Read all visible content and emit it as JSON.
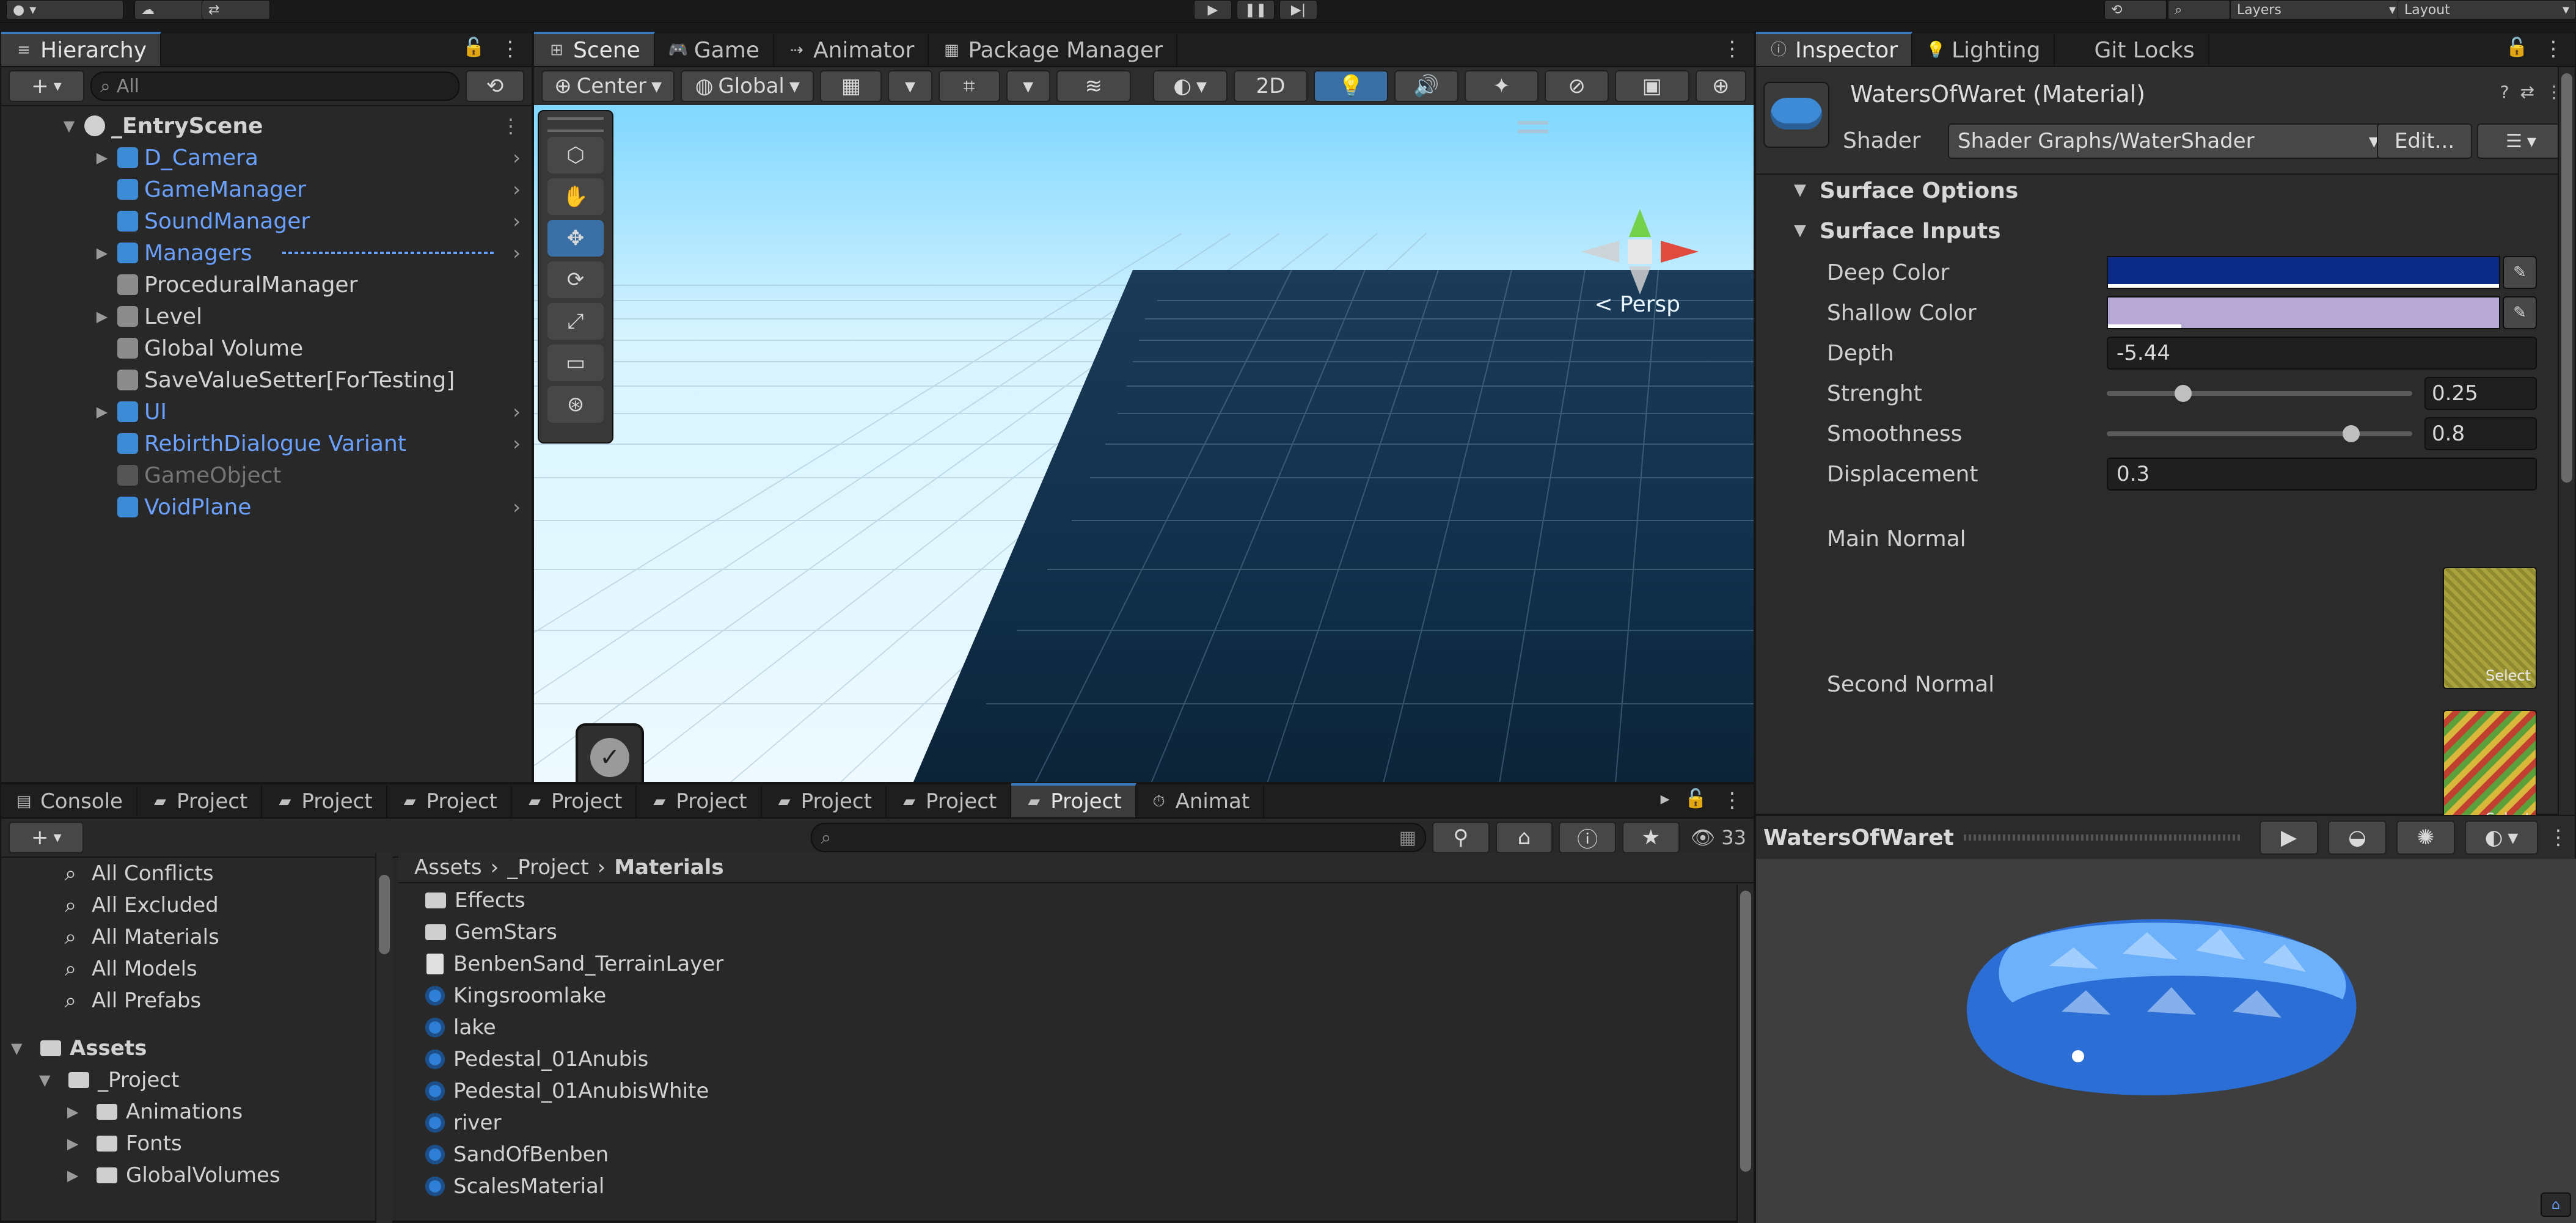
{
  "topbar": {
    "layers_label": "Layers",
    "layout_label": "Layout",
    "play_icon": "play-icon",
    "pause_icon": "pause-icon",
    "step_icon": "step-icon"
  },
  "hierarchy": {
    "tab_label": "Hierarchy",
    "search_placeholder": "All",
    "scene_name": "_EntryScene",
    "items": [
      {
        "label": "D_Camera",
        "blue": true,
        "has_arrow": true,
        "has_right_chevron": true
      },
      {
        "label": "GameManager",
        "blue": true,
        "has_arrow": false,
        "has_right_chevron": true
      },
      {
        "label": "SoundManager",
        "blue": true,
        "has_arrow": false,
        "has_right_chevron": true
      },
      {
        "label": "Managers",
        "blue": true,
        "has_arrow": true,
        "has_right_chevron": true
      },
      {
        "label": "ProceduralManager",
        "blue": false,
        "has_arrow": false,
        "has_right_chevron": false
      },
      {
        "label": "Level",
        "blue": false,
        "has_arrow": true,
        "has_right_chevron": false
      },
      {
        "label": "Global Volume",
        "blue": false,
        "has_arrow": false,
        "has_right_chevron": false
      },
      {
        "label": "SaveValueSetter[ForTesting]",
        "blue": false,
        "has_arrow": false,
        "has_right_chevron": false
      },
      {
        "label": "UI",
        "blue": true,
        "has_arrow": true,
        "has_right_chevron": true
      },
      {
        "label": "RebirthDialogue Variant",
        "blue": true,
        "has_arrow": false,
        "has_right_chevron": true
      },
      {
        "label": "GameObject",
        "blue": false,
        "has_arrow": false,
        "has_right_chevron": false,
        "dim": true
      },
      {
        "label": "VoidPlane",
        "blue": true,
        "has_arrow": false,
        "has_right_chevron": true
      }
    ]
  },
  "scene_tabs": [
    {
      "label": "Scene",
      "active": true,
      "icon": "scene-icon"
    },
    {
      "label": "Game",
      "active": false,
      "icon": "game-icon"
    },
    {
      "label": "Animator",
      "active": false,
      "icon": "animator-icon"
    },
    {
      "label": "Package Manager",
      "active": false,
      "icon": "package-manager-icon"
    }
  ],
  "scene_toolbar": {
    "pivot_label": "Center",
    "space_label": "Global",
    "mode_2d_label": "2D",
    "persp_label": "< Persp"
  },
  "inspector": {
    "tabs": [
      {
        "label": "Inspector",
        "active": true
      },
      {
        "label": "Lighting",
        "active": false
      },
      {
        "label": "Git Locks",
        "active": false
      }
    ],
    "material_title": "WatersOfWaret (Material)",
    "shader_label": "Shader",
    "shader_value": "Shader Graphs/WaterShader",
    "edit_button_label": "Edit...",
    "menu_button_glyph": "☰",
    "sections": [
      {
        "label": "Surface Options"
      },
      {
        "label": "Surface Inputs"
      }
    ],
    "props": {
      "deep_color_label": "Deep Color",
      "shallow_color_label": "Shallow Color",
      "depth_label": "Depth",
      "depth_value": "-5.44",
      "strength_label": "Strenght",
      "strength_value": "0.25",
      "smoothness_label": "Smoothness",
      "smoothness_value": "0.8",
      "displacement_label": "Displacement",
      "displacement_value": "0.3",
      "main_normal_label": "Main Normal",
      "second_normal_label": "Second Normal",
      "select_label": "Select"
    },
    "colors": {
      "deep_color": "#0b2a86",
      "shallow_color": "#b7a9d6"
    },
    "sliders": {
      "strength_fraction": 0.25,
      "smoothness_fraction": 0.8
    }
  },
  "bottom_tabs": [
    {
      "label": "Console",
      "active": false,
      "icon": "console-icon"
    },
    {
      "label": "Project",
      "active": false,
      "icon": "folder-icon"
    },
    {
      "label": "Project",
      "active": false,
      "icon": "folder-icon"
    },
    {
      "label": "Project",
      "active": false,
      "icon": "folder-icon"
    },
    {
      "label": "Project",
      "active": false,
      "icon": "folder-icon"
    },
    {
      "label": "Project",
      "active": false,
      "icon": "folder-icon"
    },
    {
      "label": "Project",
      "active": false,
      "icon": "folder-icon"
    },
    {
      "label": "Project",
      "active": false,
      "icon": "folder-icon"
    },
    {
      "label": "Project",
      "active": true,
      "icon": "folder-icon"
    },
    {
      "label": "Animat",
      "active": false,
      "icon": "clock-icon"
    }
  ],
  "project": {
    "search_placeholder": "",
    "badge_count": "33",
    "left_filters": [
      "All Conflicts",
      "All Excluded",
      "All Materials",
      "All Models",
      "All Prefabs"
    ],
    "left_tree": [
      {
        "label": "Assets",
        "level": 0,
        "expanded": true
      },
      {
        "label": "_Project",
        "level": 1,
        "expanded": true
      },
      {
        "label": "Animations",
        "level": 2,
        "expanded": false
      },
      {
        "label": "Fonts",
        "level": 2,
        "expanded": false
      },
      {
        "label": "GlobalVolumes",
        "level": 2,
        "expanded": false
      }
    ],
    "breadcrumb": [
      "Assets",
      "_Project",
      "Materials"
    ],
    "files": [
      {
        "label": "Effects",
        "type": "folder"
      },
      {
        "label": "GemStars",
        "type": "folder"
      },
      {
        "label": "BenbenSand_TerrainLayer",
        "type": "file"
      },
      {
        "label": "Kingsroomlake",
        "type": "material"
      },
      {
        "label": "lake",
        "type": "material"
      },
      {
        "label": "Pedestal_01Anubis",
        "type": "material"
      },
      {
        "label": "Pedestal_01AnubisWhite",
        "type": "material"
      },
      {
        "label": "river",
        "type": "material"
      },
      {
        "label": "SandOfBenben",
        "type": "material"
      },
      {
        "label": "ScalesMaterial",
        "type": "material"
      }
    ]
  },
  "preview": {
    "title": "WatersOfWaret"
  }
}
